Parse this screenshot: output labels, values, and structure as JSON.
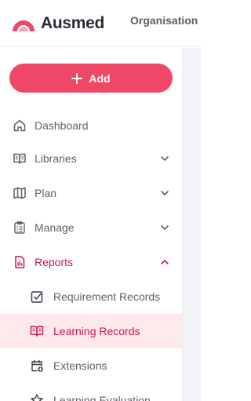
{
  "brand": {
    "name": "Ausmed",
    "accent": "#ef4867",
    "accent_dark": "#c8174b"
  },
  "header": {
    "organisation_label": "Organisation"
  },
  "sidebar": {
    "add_button": {
      "label": "Add",
      "icon": "plus-icon"
    },
    "items": [
      {
        "label": "Dashboard",
        "icon": "home-icon",
        "expandable": false
      },
      {
        "label": "Libraries",
        "icon": "book-icon",
        "expandable": true,
        "expanded": false
      },
      {
        "label": "Plan",
        "icon": "map-icon",
        "expandable": true,
        "expanded": false
      },
      {
        "label": "Manage",
        "icon": "clipboard-icon",
        "expandable": true,
        "expanded": false
      },
      {
        "label": "Reports",
        "icon": "report-icon",
        "expandable": true,
        "expanded": true,
        "active": true
      }
    ],
    "report_subitems": [
      {
        "label": "Requirement Records",
        "icon": "checkbox-icon"
      },
      {
        "label": "Learning Records",
        "icon": "open-book-icon",
        "selected": true
      },
      {
        "label": "Extensions",
        "icon": "calendar-plus-icon"
      },
      {
        "label": "Learning Evaluation",
        "icon": "star-icon"
      }
    ]
  }
}
